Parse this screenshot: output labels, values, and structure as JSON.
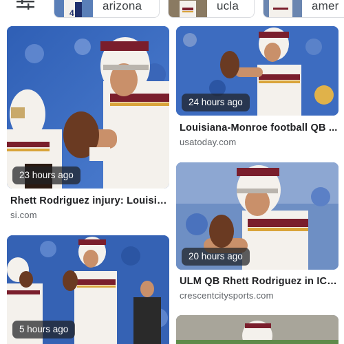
{
  "chips": [
    {
      "label": "arizona",
      "thumb_icon": "football-player-thumbnail"
    },
    {
      "label": "ucla",
      "thumb_icon": "football-player-thumbnail"
    },
    {
      "label": "amer",
      "thumb_icon": "football-player-thumbnail"
    }
  ],
  "results": [
    {
      "age": "23 hours ago",
      "title": "Rhett Rodriguez injury: Louisian...",
      "source": "si.com"
    },
    {
      "age": "24 hours ago",
      "title": "Louisiana-Monroe football QB ...",
      "source": "usatoday.com"
    },
    {
      "age": "20 hours ago",
      "title": "ULM QB Rhett Rodriguez in ICU...",
      "source": "crescentcitysports.com"
    },
    {
      "age": "5 hours ago"
    },
    {}
  ],
  "colors": {
    "crowd_blue": "#3f6fc7",
    "jersey_white": "#f4f1ec",
    "jersey_maroon": "#7a1e2c",
    "jersey_gold": "#d9a43a",
    "badge_bg": "rgba(32,33,36,0.72)"
  }
}
